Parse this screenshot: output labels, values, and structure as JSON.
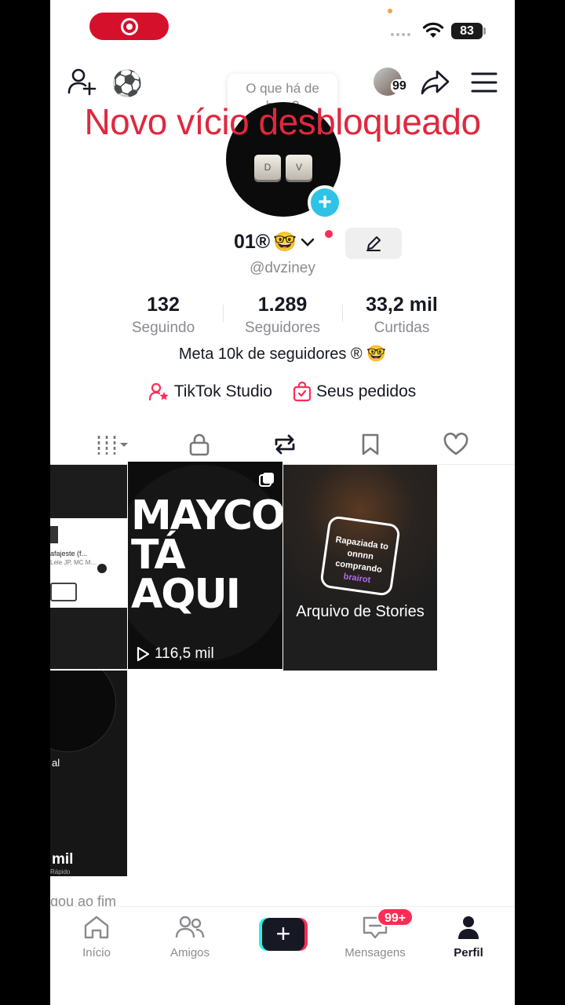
{
  "status_bar": {
    "battery": "83"
  },
  "header": {
    "tooltip": "O que há de bom?",
    "notification_count": "99",
    "overlay_title": "Novo vício desbloqueado"
  },
  "profile": {
    "display_name": "01®",
    "handle": "@dvziney",
    "keycap_left": "D",
    "keycap_right": "V",
    "stats": [
      {
        "value": "132",
        "label": "Seguindo"
      },
      {
        "value": "1.289",
        "label": "Seguidores"
      },
      {
        "value": "33,2 mil",
        "label": "Curtidas"
      }
    ],
    "bio": "Meta 10k de seguidores ® 🤓",
    "links": {
      "studio": "TikTok Studio",
      "orders": "Seus pedidos"
    }
  },
  "grid": {
    "tile1_song": "afajeste (f...",
    "tile1_artists": "Lele JP, MC M...",
    "tile2_text": "MAYCON TÁ AQUI",
    "tile2_views": "116,5 mil",
    "tile3_card_line1": "Rapaziada to",
    "tile3_card_line2": "onnnn comprando",
    "tile3_card_line3": "brairot",
    "tile3_title": "Arquivo de Stories",
    "tile4_mid": "al",
    "tile4_bottom": "mil",
    "tile4_speed": "Rápido"
  },
  "footer_text": "gou ao fim",
  "nav": {
    "home": "Início",
    "friends": "Amigos",
    "messages": "Mensagens",
    "messages_badge": "99+",
    "profile": "Perfil"
  },
  "colors": {
    "accent_red": "#fe2c55",
    "accent_cyan": "#25f4ee",
    "overlay_red": "#e0283e"
  }
}
